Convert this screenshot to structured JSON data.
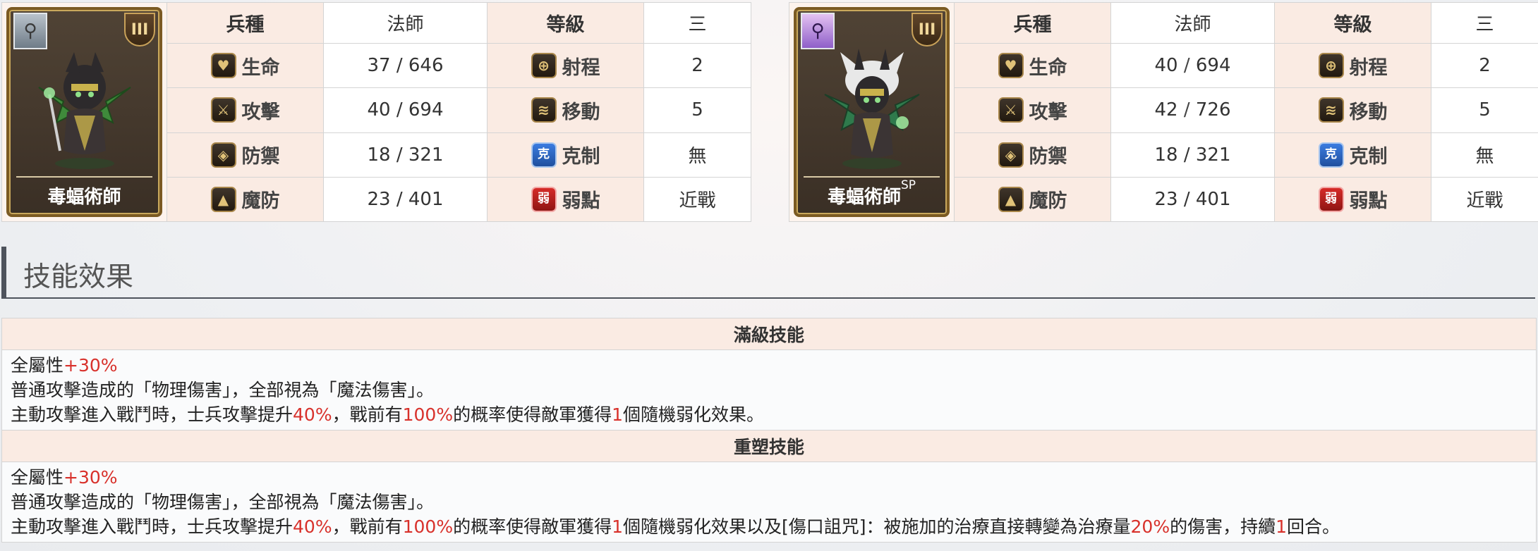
{
  "heroes": [
    {
      "name": "毒蝠術師",
      "name_sup": "",
      "class_icon": "magnifier-icon",
      "rank_badge": "III",
      "header": {
        "type_label": "兵種",
        "type_value": "法師",
        "level_label": "等級",
        "level_value": "三"
      },
      "rows": [
        {
          "label": "生命",
          "icon": "heart-icon",
          "value": "37 / 646",
          "value_a": "",
          "value_b": "",
          "highlight": false,
          "label2": "射程",
          "icon2": "crosshair-icon",
          "value2": "2"
        },
        {
          "label": "攻擊",
          "icon": "sword-icon",
          "value": "40 / 694",
          "value_a": "",
          "value_b": "",
          "highlight": false,
          "label2": "移動",
          "icon2": "wing-icon",
          "value2": "5"
        },
        {
          "label": "防禦",
          "icon": "shield-icon",
          "value": "18 / 321",
          "value_a": "",
          "value_b": "",
          "highlight": false,
          "label2": "克制",
          "icon2": "counter-icon",
          "icon2_text": "克",
          "value2": "無"
        },
        {
          "label": "魔防",
          "icon": "magic-defense-icon",
          "value": "23 / 401",
          "value_a": "",
          "value_b": "",
          "highlight": false,
          "label2": "弱點",
          "icon2": "weakness-icon",
          "icon2_text": "弱",
          "value2": "近戰"
        }
      ]
    },
    {
      "name": "毒蝠術師",
      "name_sup": "SP",
      "class_icon": "magnifier-sp-icon",
      "class_sup": "SP",
      "rank_badge": "III",
      "header": {
        "type_label": "兵種",
        "type_value": "法師",
        "level_label": "等級",
        "level_value": "三"
      },
      "rows": [
        {
          "label": "生命",
          "icon": "heart-icon",
          "value_a": "40",
          "value_b": "694",
          "highlight": true,
          "label2": "射程",
          "icon2": "crosshair-icon",
          "value2": "2"
        },
        {
          "label": "攻擊",
          "icon": "sword-icon",
          "value_a": "42",
          "value_b": "726",
          "highlight": true,
          "label2": "移動",
          "icon2": "wing-icon",
          "value2": "5"
        },
        {
          "label": "防禦",
          "icon": "shield-icon",
          "value": "18 / 321",
          "highlight": false,
          "label2": "克制",
          "icon2": "counter-icon",
          "icon2_text": "克",
          "value2": "無"
        },
        {
          "label": "魔防",
          "icon": "magic-defense-icon",
          "value": "23 / 401",
          "highlight": false,
          "label2": "弱點",
          "icon2": "weakness-icon",
          "icon2_text": "弱",
          "value2": "近戰"
        }
      ]
    }
  ],
  "section_title": "技能效果",
  "skills": [
    {
      "title": "滿級技能",
      "lines": [
        [
          {
            "t": "全屬性"
          },
          {
            "t": "+30%",
            "hl": true
          }
        ],
        [
          {
            "t": "普通攻擊造成的「物理傷害」，全部視為「魔法傷害」。"
          }
        ],
        [
          {
            "t": "主動攻擊進入戰鬥時，士兵攻擊提升"
          },
          {
            "t": "40%",
            "hl": true
          },
          {
            "t": "，戰前有"
          },
          {
            "t": "100%",
            "hl": true
          },
          {
            "t": "的概率使得敵軍獲得"
          },
          {
            "t": "1",
            "hl": true
          },
          {
            "t": "個隨機弱化效果。"
          }
        ]
      ]
    },
    {
      "title": "重塑技能",
      "lines": [
        [
          {
            "t": "全屬性"
          },
          {
            "t": "+30%",
            "hl": true
          }
        ],
        [
          {
            "t": "普通攻擊造成的「物理傷害」，全部視為「魔法傷害」。"
          }
        ],
        [
          {
            "t": "主動攻擊進入戰鬥時，士兵攻擊提升"
          },
          {
            "t": "40%",
            "hl": true
          },
          {
            "t": "，戰前有"
          },
          {
            "t": "100%",
            "hl": true
          },
          {
            "t": "的概率使得敵軍獲得"
          },
          {
            "t": "1",
            "hl": true
          },
          {
            "t": "個隨機弱化效果以及[傷口詛咒]：被施加的治療直接轉變為治療量"
          },
          {
            "t": "20%",
            "hl": true
          },
          {
            "t": "的傷害，持續"
          },
          {
            "t": "1",
            "hl": true
          },
          {
            "t": "回合。"
          }
        ]
      ]
    }
  ],
  "colors": {
    "highlight": "#d8312b",
    "header_bg": "#faebe3",
    "stat_red": "#a33e3a"
  }
}
